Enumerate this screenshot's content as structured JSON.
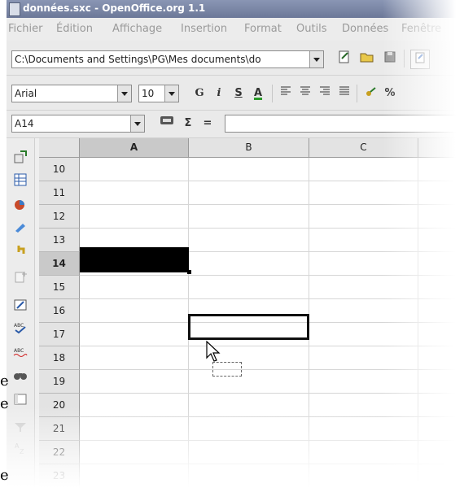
{
  "window": {
    "title": "données.sxc - OpenOffice.org 1.1"
  },
  "menu": [
    "Fichier",
    "Édition",
    "Affichage",
    "Insertion",
    "Format",
    "Outils",
    "Données",
    "Fenêtre"
  ],
  "function_bar": {
    "url": "C:\\Documents and Settings\\PG\\Mes documents\\do"
  },
  "object_bar": {
    "font_name": "Arial",
    "font_size": "10",
    "bold": "G",
    "italic": "i",
    "underline": "S",
    "font_color": "A",
    "percent": "%"
  },
  "formula_bar": {
    "name_box": "A14",
    "sum": "Σ",
    "equals": "=",
    "content": ""
  },
  "columns": [
    "A",
    "B",
    "C"
  ],
  "rows": [
    "10",
    "11",
    "12",
    "13",
    "14",
    "15",
    "16",
    "17",
    "18",
    "19",
    "20",
    "21",
    "22",
    "23"
  ],
  "active": {
    "column": "A",
    "row": "14"
  },
  "stray_text": [
    "e",
    "e",
    "e"
  ]
}
